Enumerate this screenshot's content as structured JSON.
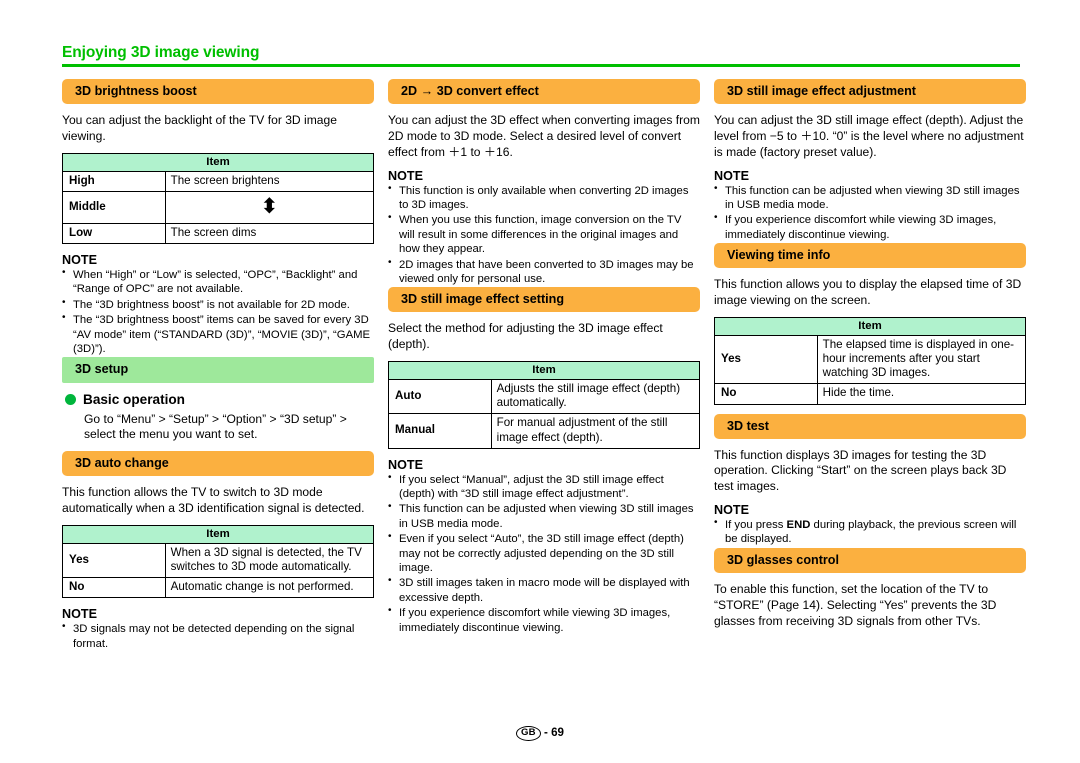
{
  "header": {
    "chapter_title": "Enjoying 3D image viewing"
  },
  "footer": {
    "region_code": "GB",
    "separator": "-",
    "page_number": "69"
  },
  "columns": [
    {
      "id": "column-1",
      "blocks": [
        {
          "kind": "orange-bar",
          "name": "heading-3d-brightness-boost",
          "text": "3D brightness boost"
        },
        {
          "kind": "paragraph",
          "name": "paragraph-3d-brightness-boost",
          "text": "You can adjust the backlight of the TV for 3D image viewing."
        },
        {
          "kind": "table",
          "name": "table-3d-brightness-boost",
          "header": "Item",
          "rows": [
            {
              "key": "High",
              "value": "The screen brightens"
            },
            {
              "key": "Middle",
              "value": "",
              "icon": "up-down-arrow-icon",
              "glyph": "⬍"
            },
            {
              "key": "Low",
              "value": "The screen dims"
            }
          ]
        },
        {
          "kind": "note",
          "name": "note-3d-brightness-boost",
          "title": "NOTE",
          "items": [
            "When “High” or “Low” is selected, “OPC”, “Backlight” and “Range of OPC” are not available.",
            "The “3D brightness boost” is not available for 2D mode.",
            "The “3D brightness boost” items can be saved for every 3D “AV mode” item (“STANDARD (3D)”, “MOVIE (3D)”, “GAME (3D)”)."
          ]
        },
        {
          "kind": "green-bar",
          "name": "heading-3d-setup",
          "text": "3D setup"
        },
        {
          "kind": "dot-heading",
          "name": "heading-basic-operation",
          "text": "Basic operation"
        },
        {
          "kind": "paragraph-indent",
          "name": "paragraph-basic-operation",
          "text": "Go to “Menu” > “Setup” > “Option” > “3D setup” > select the menu you want to set."
        },
        {
          "kind": "orange-bar",
          "name": "heading-3d-auto-change",
          "text": "3D auto change"
        },
        {
          "kind": "paragraph",
          "name": "paragraph-3d-auto-change",
          "text": "This function allows the TV to switch to 3D mode automatically when a 3D identification signal is detected."
        },
        {
          "kind": "table",
          "name": "table-3d-auto-change",
          "header": "Item",
          "rows": [
            {
              "key": "Yes",
              "value": "When a 3D signal is detected, the TV switches to 3D mode automatically."
            },
            {
              "key": "No",
              "value": "Automatic change is not performed."
            }
          ]
        },
        {
          "kind": "note",
          "name": "note-3d-auto-change",
          "title": "NOTE",
          "items": [
            "3D signals may not be detected depending on the signal format."
          ]
        }
      ]
    },
    {
      "id": "column-2",
      "blocks": [
        {
          "kind": "orange-bar",
          "name": "heading-2d-to-3d-convert-effect",
          "text": "2D → 3D convert effect"
        },
        {
          "kind": "paragraph",
          "name": "paragraph-2d-to-3d-convert-effect",
          "text": "You can adjust the 3D effect when converting images from 2D mode to 3D mode. Select a desired level of convert effect from ＋1 to ＋16."
        },
        {
          "kind": "note",
          "name": "note-2d-to-3d-convert-effect",
          "title": "NOTE",
          "items": [
            "This function is only available when converting 2D images to 3D images.",
            "When you use this function, image conversion on the TV will result in some differences in the original images and how they appear.",
            "2D images that have been converted to 3D images may be viewed only for personal use."
          ]
        },
        {
          "kind": "orange-bar",
          "name": "heading-3d-still-image-effect-setting",
          "text": "3D still image effect setting"
        },
        {
          "kind": "paragraph",
          "name": "paragraph-3d-still-image-effect-setting",
          "text": "Select the method for adjusting the 3D image effect (depth)."
        },
        {
          "kind": "table",
          "name": "table-3d-still-image-effect-setting",
          "header": "Item",
          "rows": [
            {
              "key": "Auto",
              "value": "Adjusts the still image effect (depth) automatically."
            },
            {
              "key": "Manual",
              "value": "For manual adjustment of the still image effect (depth)."
            }
          ]
        },
        {
          "kind": "note",
          "name": "note-3d-still-image-effect-setting",
          "title": "NOTE",
          "items": [
            "If you select “Manual”, adjust the 3D still image effect (depth) with “3D still image effect adjustment”.",
            "This function can be adjusted when viewing 3D still images in USB media mode.",
            "Even if you select “Auto”, the 3D still image effect (depth) may not be correctly adjusted depending on the 3D still image.",
            "3D still images taken in macro mode will be displayed with excessive depth.",
            "If you experience discomfort while viewing 3D images, immediately discontinue viewing."
          ]
        }
      ]
    },
    {
      "id": "column-3",
      "blocks": [
        {
          "kind": "orange-bar",
          "name": "heading-3d-still-image-effect-adjustment",
          "text": "3D still image effect adjustment"
        },
        {
          "kind": "paragraph",
          "name": "paragraph-3d-still-image-effect-adjustment",
          "text": "You can adjust the 3D still image effect (depth). Adjust the level from −5 to ＋10. “0” is the level where no adjustment is made (factory preset value)."
        },
        {
          "kind": "note",
          "name": "note-3d-still-image-effect-adjustment",
          "title": "NOTE",
          "items": [
            "This function can be adjusted when viewing 3D still images in USB media mode.",
            "If you experience discomfort while viewing 3D images, immediately discontinue viewing."
          ]
        },
        {
          "kind": "orange-bar",
          "name": "heading-viewing-time-info",
          "text": "Viewing time info"
        },
        {
          "kind": "paragraph",
          "name": "paragraph-viewing-time-info",
          "text": "This function allows you to display the elapsed time of 3D image viewing on the screen."
        },
        {
          "kind": "table",
          "name": "table-viewing-time-info",
          "header": "Item",
          "rows": [
            {
              "key": "Yes",
              "value": "The elapsed time is displayed in one-hour increments after you start watching 3D images."
            },
            {
              "key": "No",
              "value": "Hide the time."
            }
          ]
        },
        {
          "kind": "orange-bar",
          "name": "heading-3d-test",
          "text": "3D test"
        },
        {
          "kind": "paragraph",
          "name": "paragraph-3d-test",
          "text": "This function displays 3D images for testing the 3D operation. Clicking “Start” on the screen plays back 3D test images."
        },
        {
          "kind": "note",
          "name": "note-3d-test",
          "title": "NOTE",
          "items": [
            "If you press END during playback, the previous screen will be displayed."
          ],
          "bold_terms": [
            "END"
          ]
        },
        {
          "kind": "orange-bar",
          "name": "heading-3d-glasses-control",
          "text": "3D glasses control"
        },
        {
          "kind": "paragraph",
          "name": "paragraph-3d-glasses-control",
          "text": "To enable this function, set the location of the TV to “STORE” (Page 14). Selecting “Yes” prevents the 3D glasses from receiving 3D signals from other TVs."
        }
      ]
    }
  ],
  "colors": {
    "chapter_green": "#00bf00",
    "bar_orange": "#fbb040",
    "bar_green": "#9ee89b",
    "table_header_green": "#b0f2cd",
    "bullet_dot_green": "#00b53c"
  }
}
